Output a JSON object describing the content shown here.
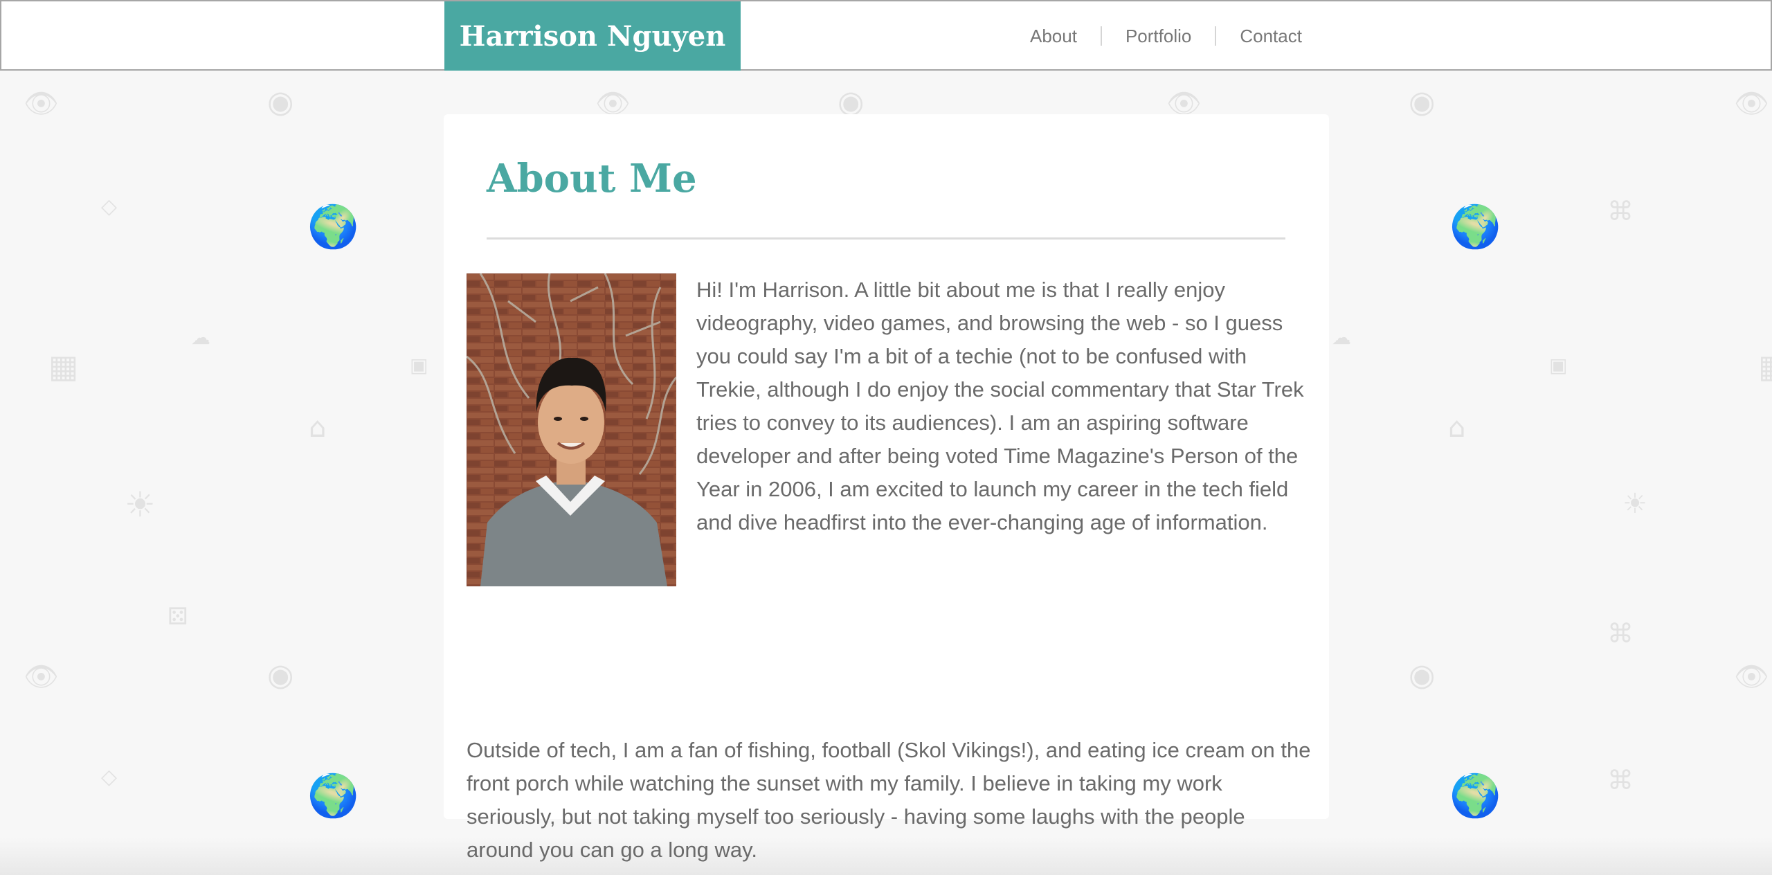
{
  "site": {
    "brand": "Harrison Nguyen",
    "brand_color": "#4aa8a2"
  },
  "nav": {
    "items": [
      {
        "label": "About"
      },
      {
        "label": "Portfolio"
      },
      {
        "label": "Contact"
      }
    ]
  },
  "about": {
    "title": "About Me",
    "photo_icon": "portrait-photo",
    "paragraph1": "Hi! I'm Harrison. A little bit about me is that I really enjoy videography, video games, and browsing the web - so I guess you could say I'm a bit of a techie (not to be confused with Trekie, although I do enjoy the social commentary that Star Trek tries to convey to its audiences). I am an aspiring software developer and after being voted Time Magazine's Person of the Year in 2006, I am excited to launch my career in the tech field and dive headfirst into the ever-changing age of information.",
    "paragraph2": "Outside of tech, I am a fan of fishing, football (Skol Vikings!), and eating ice cream on the front porch while watching the sunset with my family. I believe in taking my work seriously, but not taking myself too seriously - having some laughs with the people around you can go a long way."
  },
  "background": {
    "pattern_icons": [
      "eye-icon",
      "globe-icon",
      "diamond-icon",
      "sun-icon",
      "cloud-icon",
      "house-icon",
      "film-icon",
      "camera-icon",
      "dice-icon"
    ]
  }
}
